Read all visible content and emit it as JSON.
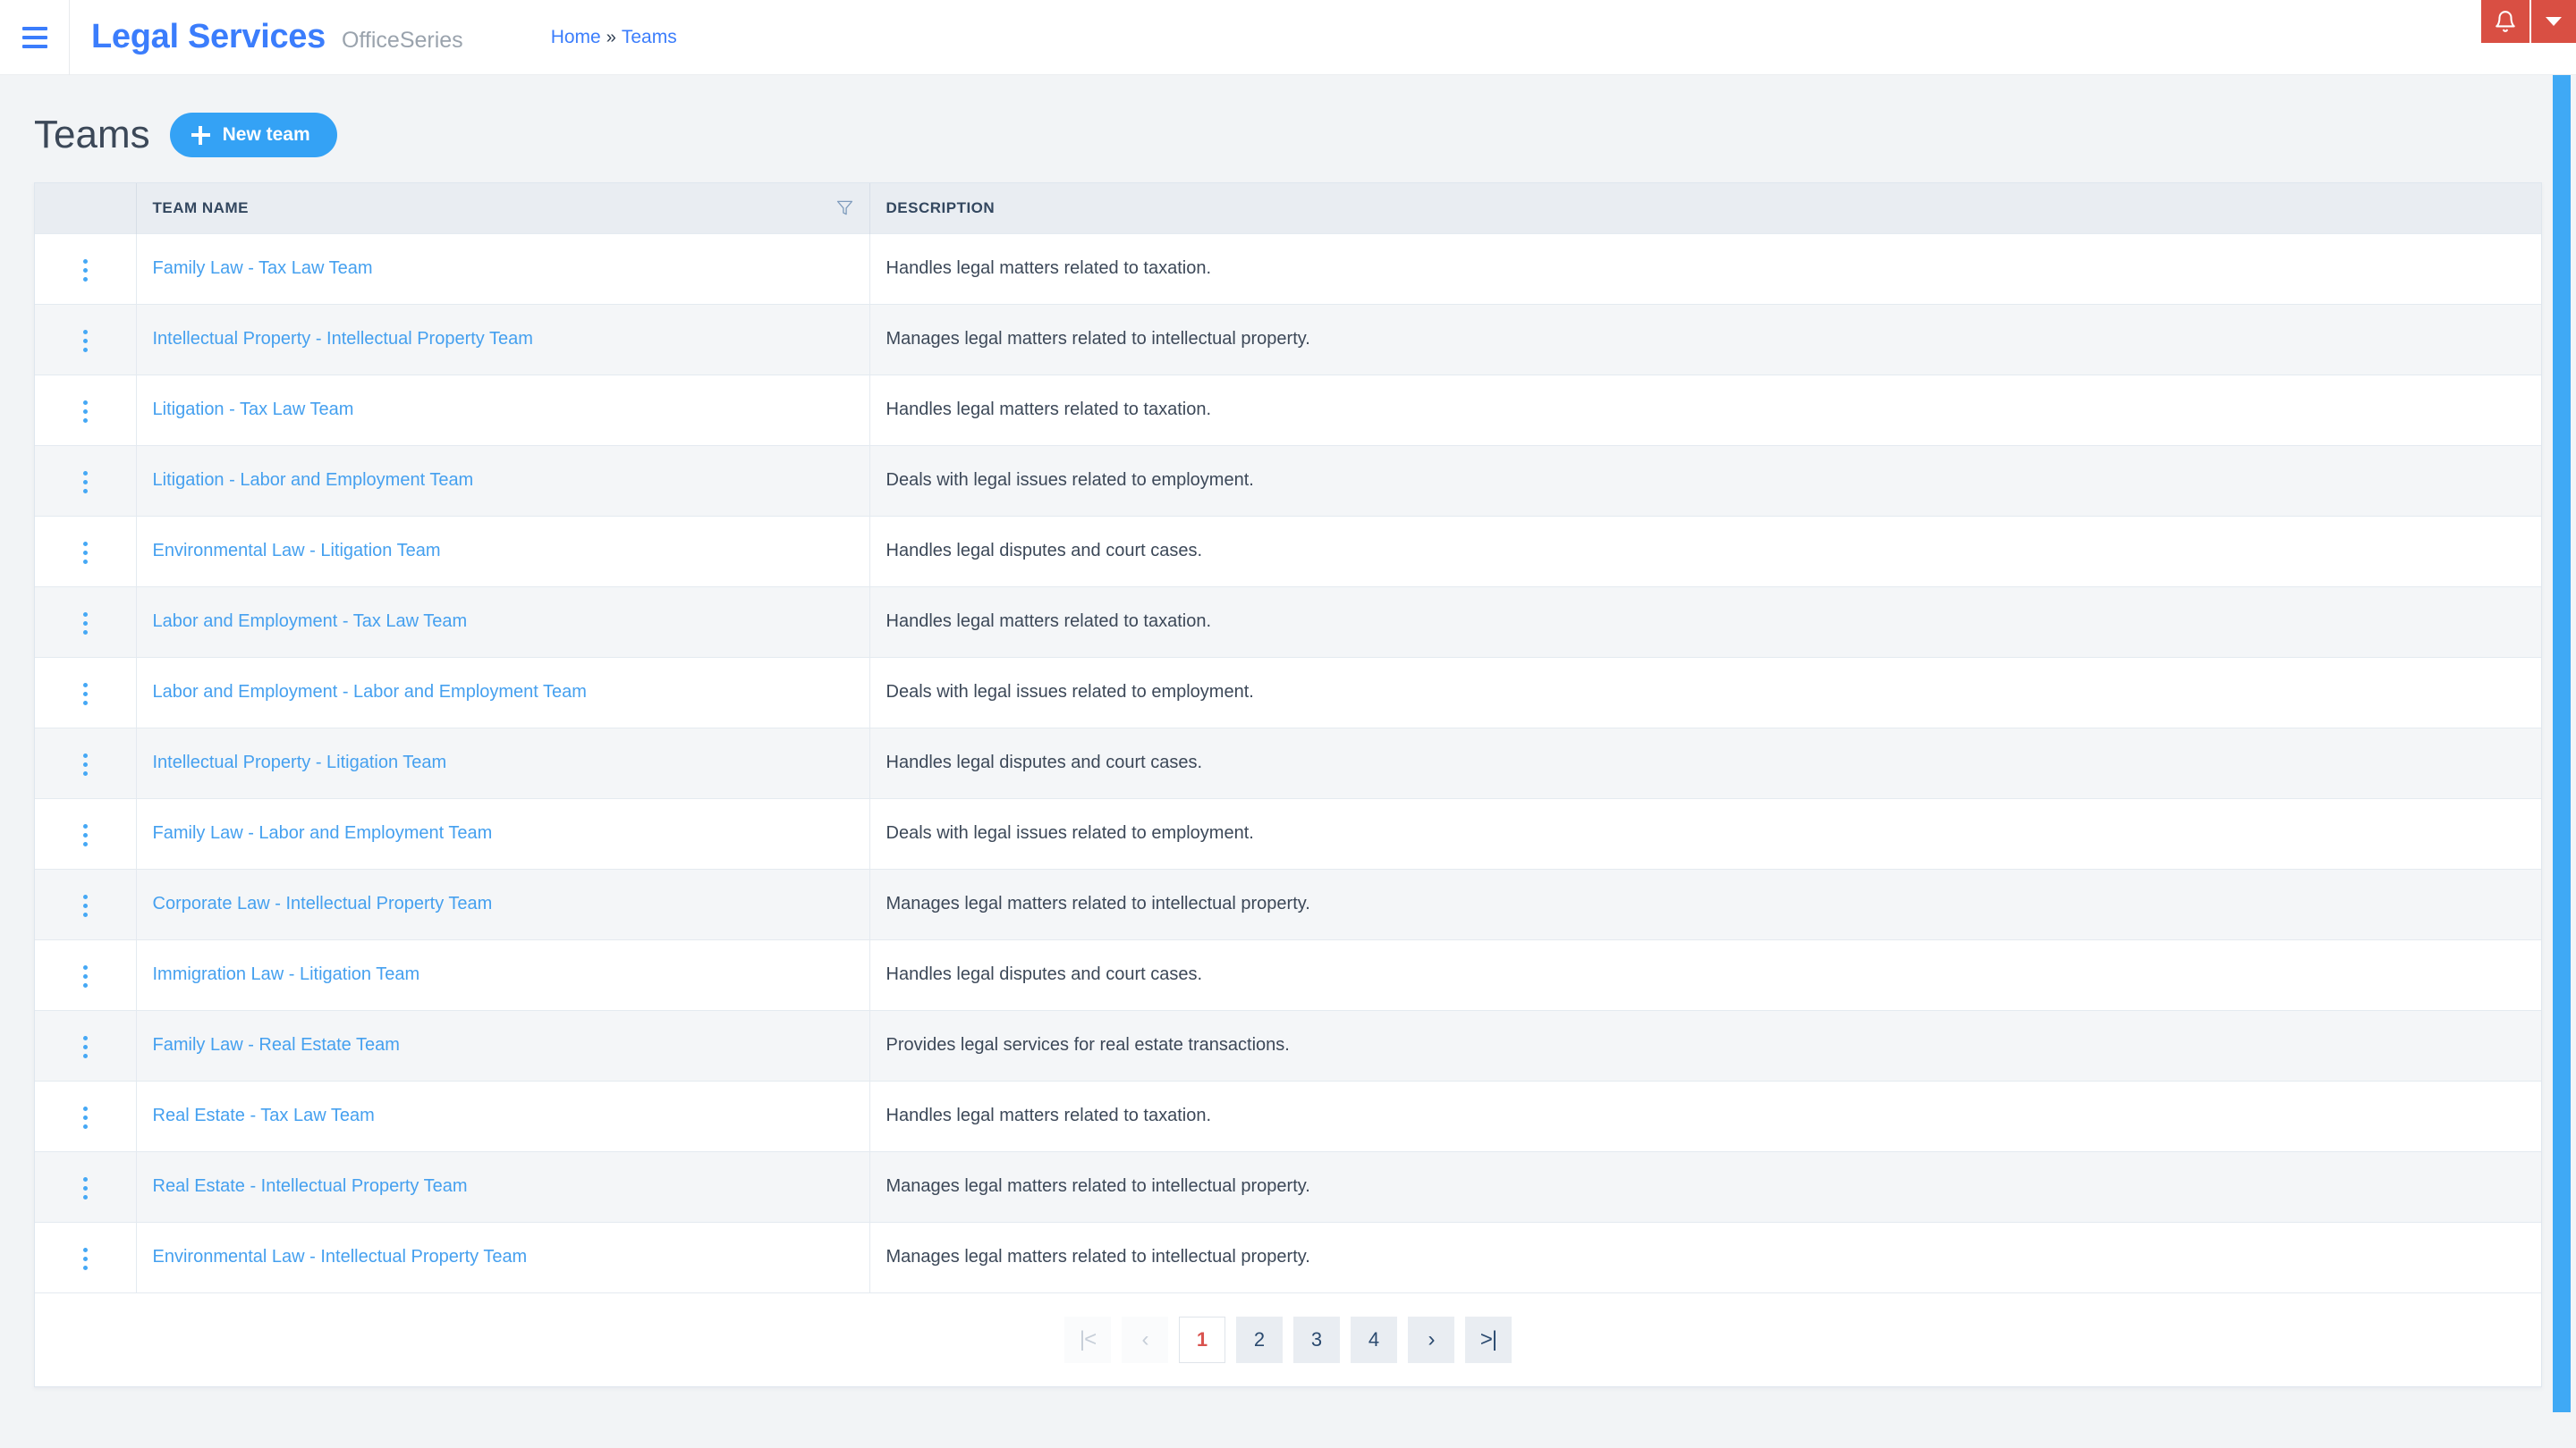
{
  "topbar": {
    "menu_icon": "hamburger-icon",
    "brand": "Legal Services",
    "brand_sub": "OfficeSeries",
    "breadcrumb": {
      "home": "Home",
      "separator": "»",
      "current": "Teams"
    },
    "notifications": {
      "bell_icon": "bell-icon",
      "caret_icon": "chevron-down-icon",
      "color": "#d94f43"
    }
  },
  "page": {
    "title": "Teams",
    "new_button": {
      "label": "New team",
      "icon": "plus-icon",
      "color": "#34a2f5"
    }
  },
  "table": {
    "columns": {
      "kebab": "",
      "name": "TEAM NAME",
      "description": "DESCRIPTION"
    },
    "filter_icon": "filter-funnel-icon",
    "row_menu_icon": "kebab-menu-icon",
    "link_color": "#45a0ef",
    "rows": [
      {
        "name": "Family Law - Tax Law Team",
        "description": "Handles legal matters related to taxation."
      },
      {
        "name": "Intellectual Property - Intellectual Property Team",
        "description": "Manages legal matters related to intellectual property."
      },
      {
        "name": "Litigation - Tax Law Team",
        "description": "Handles legal matters related to taxation."
      },
      {
        "name": "Litigation - Labor and Employment Team",
        "description": "Deals with legal issues related to employment."
      },
      {
        "name": "Environmental Law - Litigation Team",
        "description": "Handles legal disputes and court cases."
      },
      {
        "name": "Labor and Employment - Tax Law Team",
        "description": "Handles legal matters related to taxation."
      },
      {
        "name": "Labor and Employment - Labor and Employment Team",
        "description": "Deals with legal issues related to employment."
      },
      {
        "name": "Intellectual Property - Litigation Team",
        "description": "Handles legal disputes and court cases."
      },
      {
        "name": "Family Law - Labor and Employment Team",
        "description": "Deals with legal issues related to employment."
      },
      {
        "name": "Corporate Law - Intellectual Property Team",
        "description": "Manages legal matters related to intellectual property."
      },
      {
        "name": "Immigration Law - Litigation Team",
        "description": "Handles legal disputes and court cases."
      },
      {
        "name": "Family Law - Real Estate Team",
        "description": "Provides legal services for real estate transactions."
      },
      {
        "name": "Real Estate - Tax Law Team",
        "description": "Handles legal matters related to taxation."
      },
      {
        "name": "Real Estate - Intellectual Property Team",
        "description": "Manages legal matters related to intellectual property."
      },
      {
        "name": "Environmental Law - Intellectual Property Team",
        "description": "Manages legal matters related to intellectual property."
      }
    ]
  },
  "pagination": {
    "first_label": "|<",
    "prev_label": "‹",
    "next_label": "›",
    "last_label": ">|",
    "pages": [
      "1",
      "2",
      "3",
      "4"
    ],
    "active_page": "1",
    "active_color": "#d9534f",
    "first_disabled": true,
    "prev_disabled": true
  }
}
